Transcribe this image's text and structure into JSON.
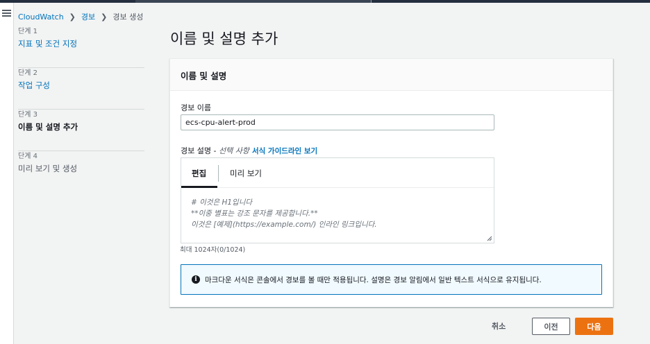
{
  "breadcrumb": {
    "items": [
      "CloudWatch",
      "경보"
    ],
    "current": "경보 생성",
    "separator": "❯"
  },
  "steps": [
    {
      "num": "단계 1",
      "label": "지표 및 조건 지정"
    },
    {
      "num": "단계 2",
      "label": "작업 구성"
    },
    {
      "num": "단계 3",
      "label": "이름 및 설명 추가"
    },
    {
      "num": "단계 4",
      "label": "미리 보기 및 생성"
    }
  ],
  "page": {
    "title": "이름 및 설명 추가"
  },
  "panel": {
    "header": "이름 및 설명",
    "name_label": "경보 이름",
    "name_value": "ecs-cpu-alert-prod",
    "desc_label": "경보 설명 - ",
    "desc_optional": "선택 사항",
    "desc_guide_link": "서식 가이드라인 보기",
    "tabs": [
      "편집",
      "미리 보기"
    ],
    "placeholder": "# 이것은 H1입니다\n**이중 별표는 강조 문자를 제공합니다.**\n이것은 [예제](https://example.com/) 인라인 링크입니다.",
    "char_count": "최대 1024자(0/1024)",
    "info_text": "마크다운 서식은 콘솔에서 경보를 볼 때만 적용됩니다. 설명은 경보 알림에서 일반 텍스트 서식으로 유지됩니다.",
    "info_icon": "info-icon"
  },
  "footer": {
    "cancel": "취소",
    "prev": "이전",
    "next": "다음"
  },
  "colors": {
    "link": "#0073bb",
    "primary": "#ec7211",
    "info_border": "#0073bb",
    "info_bg": "#f1faff"
  }
}
